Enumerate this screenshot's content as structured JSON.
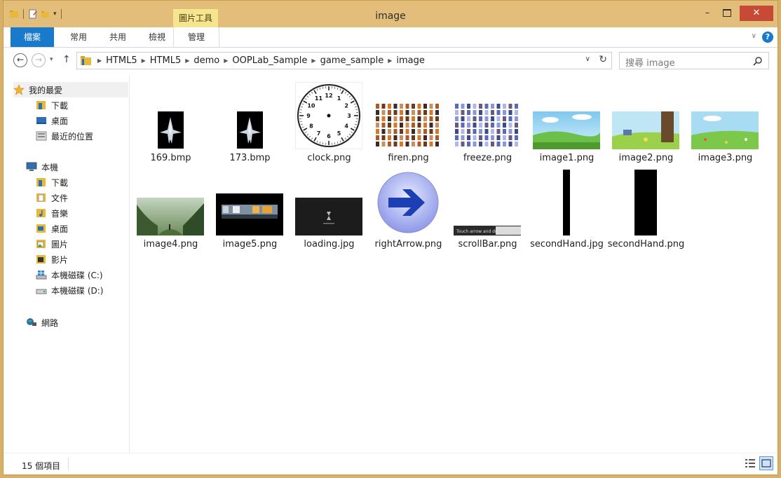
{
  "window": {
    "title": "image"
  },
  "ribbon": {
    "context_header": "圖片工具",
    "tabs": [
      "檔案",
      "常用",
      "共用",
      "檢視",
      "管理"
    ]
  },
  "address": {
    "crumbs": [
      "HTML5",
      "HTML5",
      "demo",
      "OOPLab_Sample",
      "game_sample",
      "image"
    ]
  },
  "search": {
    "placeholder": "搜尋 image"
  },
  "nav": {
    "favorites": "我的最愛",
    "fav_items": [
      "下載",
      "桌面",
      "最近的位置"
    ],
    "this_pc": "本機",
    "pc_items": [
      "下載",
      "文件",
      "音樂",
      "桌面",
      "圖片",
      "影片",
      "本機磁碟 (C:)",
      "本機磁碟 (D:)"
    ],
    "network": "網路"
  },
  "files": [
    {
      "name": "169.bmp",
      "icon": "spaceship-thumbnail"
    },
    {
      "name": "173.bmp",
      "icon": "spaceship-thumbnail"
    },
    {
      "name": "clock.png",
      "icon": "clock-thumbnail"
    },
    {
      "name": "firen.png",
      "icon": "sprite-sheet-thumbnail"
    },
    {
      "name": "freeze.png",
      "icon": "sprite-sheet-thumbnail"
    },
    {
      "name": "image1.png",
      "icon": "landscape-thumbnail"
    },
    {
      "name": "image2.png",
      "icon": "landscape-thumbnail"
    },
    {
      "name": "image3.png",
      "icon": "landscape-thumbnail"
    },
    {
      "name": "image4.png",
      "icon": "landscape-thumbnail"
    },
    {
      "name": "image5.png",
      "icon": "city-night-thumbnail"
    },
    {
      "name": "loading.jpg",
      "icon": "loading-thumbnail"
    },
    {
      "name": "rightArrow.png",
      "icon": "right-arrow-thumbnail"
    },
    {
      "name": "scrollBar.png",
      "icon": "scrollbar-thumbnail"
    },
    {
      "name": "secondHand.jpg",
      "icon": "second-hand-thumbnail"
    },
    {
      "name": "secondHand.png",
      "icon": "second-hand-thumbnail"
    }
  ],
  "clock_numbers": [
    "12",
    "1",
    "2",
    "3",
    "4",
    "5",
    "6",
    "7",
    "8",
    "9",
    "10",
    "11"
  ],
  "scrollbar_text": "Touch  arrow and drag",
  "status": {
    "item_count": "15 個項目"
  },
  "colors": {
    "accent": "#1979ca",
    "titlebar": "#e3bd7a",
    "close": "#c74a37",
    "context_tab": "#f5e58f"
  }
}
